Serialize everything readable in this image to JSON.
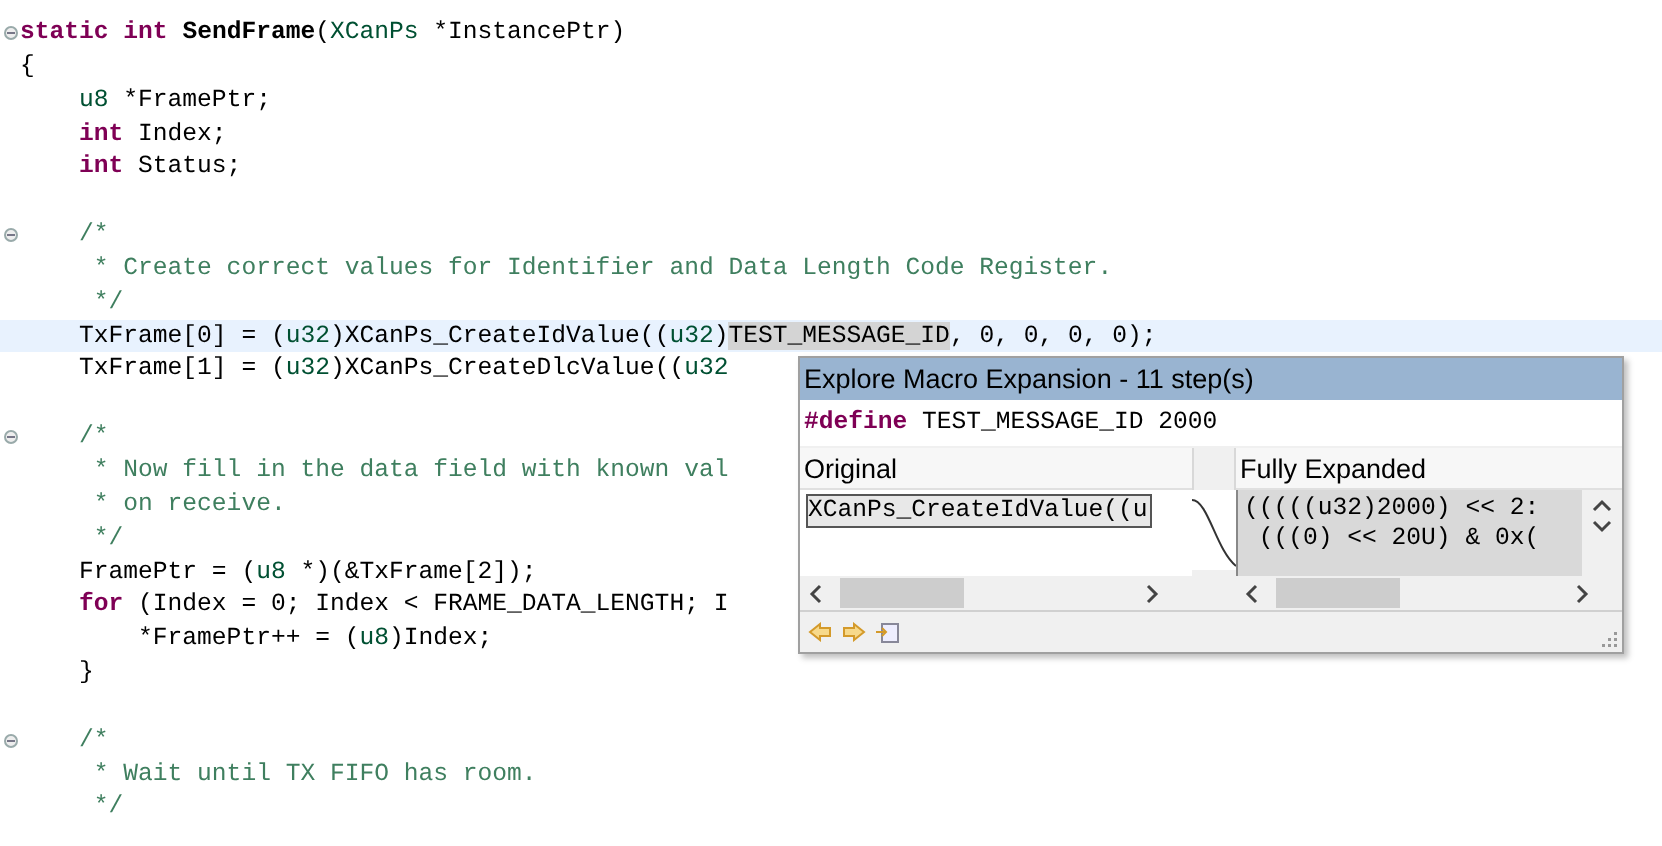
{
  "editor": {
    "lines": [
      {
        "fold": true,
        "current": false,
        "tokens": [
          {
            "kind": "keyword",
            "text": "static "
          },
          {
            "kind": "keyword",
            "text": "int "
          },
          {
            "kind": "function",
            "text": "SendFrame"
          },
          {
            "kind": "plain",
            "text": "("
          },
          {
            "kind": "type",
            "text": "XCanPs"
          },
          {
            "kind": "plain",
            "text": " *InstancePtr)"
          }
        ]
      },
      {
        "fold": false,
        "current": false,
        "tokens": [
          {
            "kind": "plain",
            "text": "{"
          }
        ]
      },
      {
        "fold": false,
        "current": false,
        "tokens": [
          {
            "kind": "type",
            "text": "    u8"
          },
          {
            "kind": "plain",
            "text": " *FramePtr;"
          }
        ]
      },
      {
        "fold": false,
        "current": false,
        "tokens": [
          {
            "kind": "keyword",
            "text": "    int"
          },
          {
            "kind": "plain",
            "text": " Index;"
          }
        ]
      },
      {
        "fold": false,
        "current": false,
        "tokens": [
          {
            "kind": "keyword",
            "text": "    int"
          },
          {
            "kind": "plain",
            "text": " Status;"
          }
        ]
      },
      {
        "fold": false,
        "current": false
      },
      {
        "fold": true,
        "current": false,
        "tokens": [
          {
            "kind": "comment",
            "text": "    /*"
          }
        ]
      },
      {
        "fold": false,
        "current": false,
        "tokens": [
          {
            "kind": "comment",
            "text": "     * Create correct values for Identifier and Data Length Code Register."
          }
        ]
      },
      {
        "fold": false,
        "current": false,
        "tokens": [
          {
            "kind": "comment",
            "text": "     */"
          }
        ]
      },
      {
        "fold": false,
        "current": true,
        "tokens": [
          {
            "kind": "plain",
            "text": "    TxFrame[0] = ("
          },
          {
            "kind": "type",
            "text": "u32"
          },
          {
            "kind": "plain",
            "text": ")XCanPs_CreateIdValue(("
          },
          {
            "kind": "type",
            "text": "u32"
          },
          {
            "kind": "plain",
            "text": ")"
          },
          {
            "kind": "highlight",
            "text": "TEST_MESSAGE_ID"
          },
          {
            "kind": "plain",
            "text": ", 0, 0, 0, 0);"
          }
        ]
      },
      {
        "fold": false,
        "current": false,
        "tokens": [
          {
            "kind": "plain",
            "text": "    TxFrame[1] = ("
          },
          {
            "kind": "type",
            "text": "u32"
          },
          {
            "kind": "plain",
            "text": ")XCanPs_CreateDlcValue(("
          },
          {
            "kind": "type",
            "text": "u32"
          }
        ]
      },
      {
        "fold": false,
        "current": false
      },
      {
        "fold": true,
        "current": false,
        "tokens": [
          {
            "kind": "comment",
            "text": "    /*"
          }
        ]
      },
      {
        "fold": false,
        "current": false,
        "tokens": [
          {
            "kind": "comment",
            "text": "     * Now fill in the data field with known val"
          }
        ]
      },
      {
        "fold": false,
        "current": false,
        "tokens": [
          {
            "kind": "comment",
            "text": "     * on receive."
          }
        ]
      },
      {
        "fold": false,
        "current": false,
        "tokens": [
          {
            "kind": "comment",
            "text": "     */"
          }
        ]
      },
      {
        "fold": false,
        "current": false,
        "tokens": [
          {
            "kind": "plain",
            "text": "    FramePtr = ("
          },
          {
            "kind": "type",
            "text": "u8"
          },
          {
            "kind": "plain",
            "text": " *)(&TxFrame[2]);"
          }
        ]
      },
      {
        "fold": false,
        "current": false,
        "tokens": [
          {
            "kind": "keyword",
            "text": "    for"
          },
          {
            "kind": "plain",
            "text": " (Index = 0; Index < FRAME_DATA_LENGTH; I"
          }
        ]
      },
      {
        "fold": false,
        "current": false,
        "tokens": [
          {
            "kind": "plain",
            "text": "        *FramePtr++ = ("
          },
          {
            "kind": "type",
            "text": "u8"
          },
          {
            "kind": "plain",
            "text": ")Index;"
          }
        ]
      },
      {
        "fold": false,
        "current": false,
        "tokens": [
          {
            "kind": "plain",
            "text": "    }"
          }
        ]
      },
      {
        "fold": false,
        "current": false
      },
      {
        "fold": true,
        "current": false,
        "tokens": [
          {
            "kind": "comment",
            "text": "    /*"
          }
        ]
      },
      {
        "fold": false,
        "current": false,
        "tokens": [
          {
            "kind": "comment",
            "text": "     * Wait until TX FIFO has room."
          }
        ]
      },
      {
        "fold": false,
        "current": false,
        "tokens": [
          {
            "kind": "comment",
            "text": "     */"
          }
        ]
      }
    ]
  },
  "popup": {
    "title": "Explore Macro Expansion - 11 step(s)",
    "define_keyword": "#define",
    "define_text": " TEST_MESSAGE_ID 2000",
    "panes": [
      {
        "header": "Original",
        "lines": [
          "XCanPs_CreateIdValue((u"
        ]
      },
      {
        "header": "Fully Expanded",
        "lines": [
          "(((((u32)2000) << 2:",
          " (((0) << 20U) & 0x("
        ]
      }
    ]
  }
}
